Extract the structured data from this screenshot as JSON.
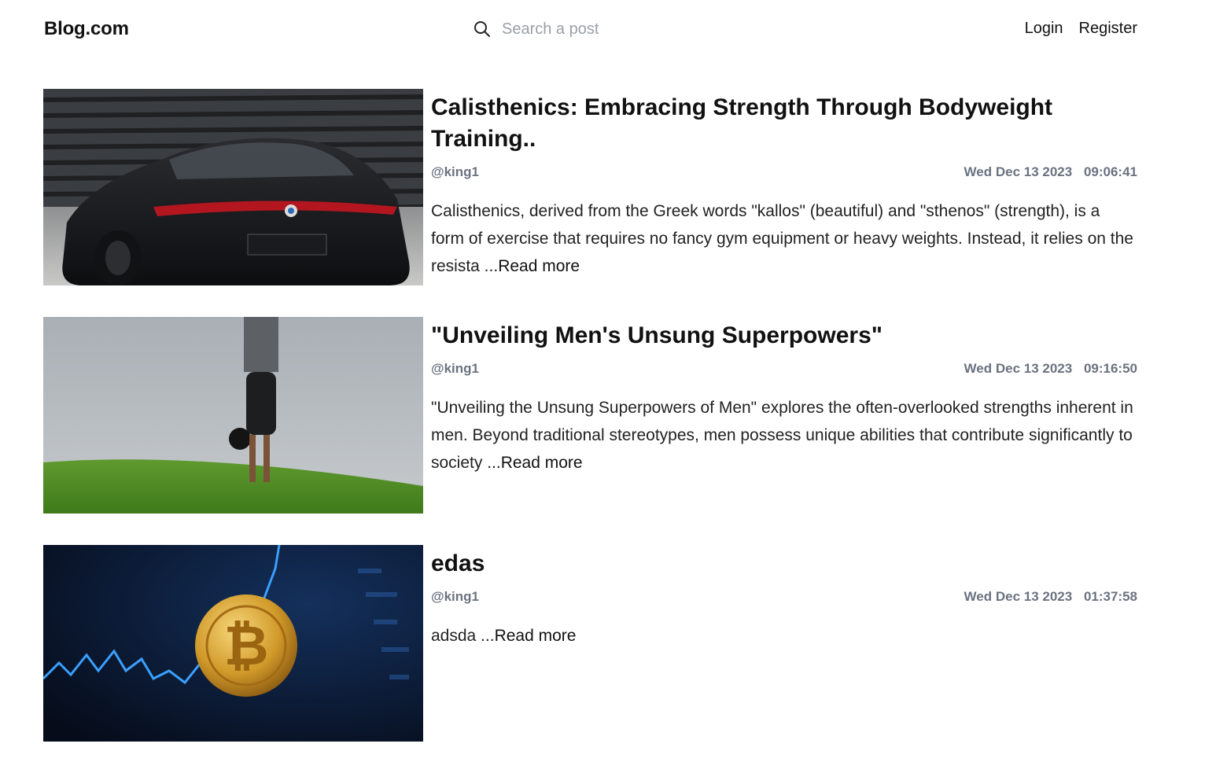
{
  "header": {
    "logo": "Blog.com",
    "search": {
      "placeholder": "Search a post",
      "value": "",
      "icon": "search-icon"
    },
    "nav": {
      "login": "Login",
      "register": "Register"
    }
  },
  "posts": [
    {
      "title": "Calisthenics: Embracing Strength Through Bodyweight Training..",
      "author": "@king1",
      "date": "Wed Dec 13 2023",
      "time": "09:06:41",
      "excerpt": "Calisthenics, derived from the Greek words \"kallos\" (beautiful) and \"sthenos\" (strength), is a form of exercise that requires no fancy gym equipment or heavy weights. Instead, it relies on the resista ...",
      "read_more": "Read more",
      "image": "black-sports-car-photo"
    },
    {
      "title": "\"Unveiling Men's Unsung Superpowers\"",
      "author": "@king1",
      "date": "Wed Dec 13 2023",
      "time": "09:16:50",
      "excerpt": "\"Unveiling the Unsung Superpowers of Men\" explores the often-overlooked strengths inherent in men. Beyond traditional stereotypes, men possess unique abilities that contribute significantly to society ...",
      "read_more": "Read more",
      "image": "handstand-on-grass-photo"
    },
    {
      "title": "edas",
      "author": "@king1",
      "date": "Wed Dec 13 2023",
      "time": "01:37:58",
      "excerpt": "adsda ...",
      "read_more": "Read more",
      "image": "bitcoin-chart-photo"
    }
  ],
  "colors": {
    "text": "#111111",
    "meta": "#6b7280",
    "placeholder": "#9aa0a6"
  }
}
